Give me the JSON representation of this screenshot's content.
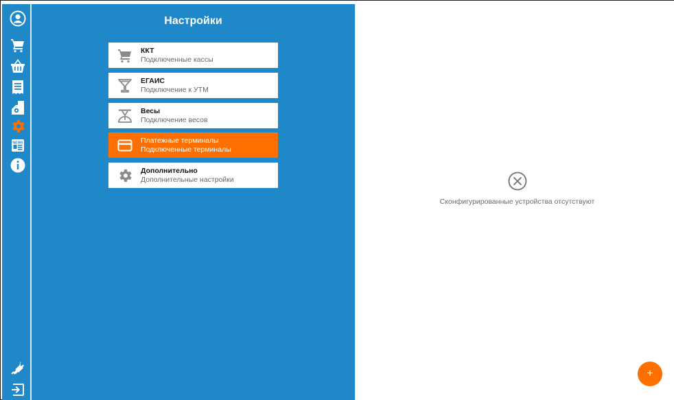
{
  "sidebar": {
    "icons": [
      "account-icon",
      "cart-icon",
      "basket-icon",
      "receipt-icon",
      "document-settings-icon",
      "gear-icon",
      "news-icon",
      "info-icon",
      "plugin-icon",
      "logout-icon"
    ],
    "active_icon": "gear-icon",
    "accent_color": "#ff6f00"
  },
  "settings": {
    "title": "Настройки",
    "items": [
      {
        "icon": "cart-icon",
        "title": "ККТ",
        "subtitle": "Подключенные кассы",
        "active": false
      },
      {
        "icon": "cocktail-icon",
        "title": "ЕГАИС",
        "subtitle": "Подключение к УТМ",
        "active": false
      },
      {
        "icon": "scale-icon",
        "title": "Весы",
        "subtitle": "Подключение весов",
        "active": false
      },
      {
        "icon": "credit-card-icon",
        "title": "Платежные терминалы",
        "subtitle": "Подключенные терминалы",
        "active": true
      },
      {
        "icon": "gear-icon",
        "title": "Дополнительно",
        "subtitle": "Дополнительные настройки",
        "active": false
      }
    ]
  },
  "content": {
    "empty_icon": "circle-x-icon",
    "empty_message": "Сконфигурированные устройства отсутствуют",
    "fab_label": "+"
  },
  "colors": {
    "primary": "#1e88c8",
    "accent": "#ff6f00",
    "background": "#ffffff"
  }
}
